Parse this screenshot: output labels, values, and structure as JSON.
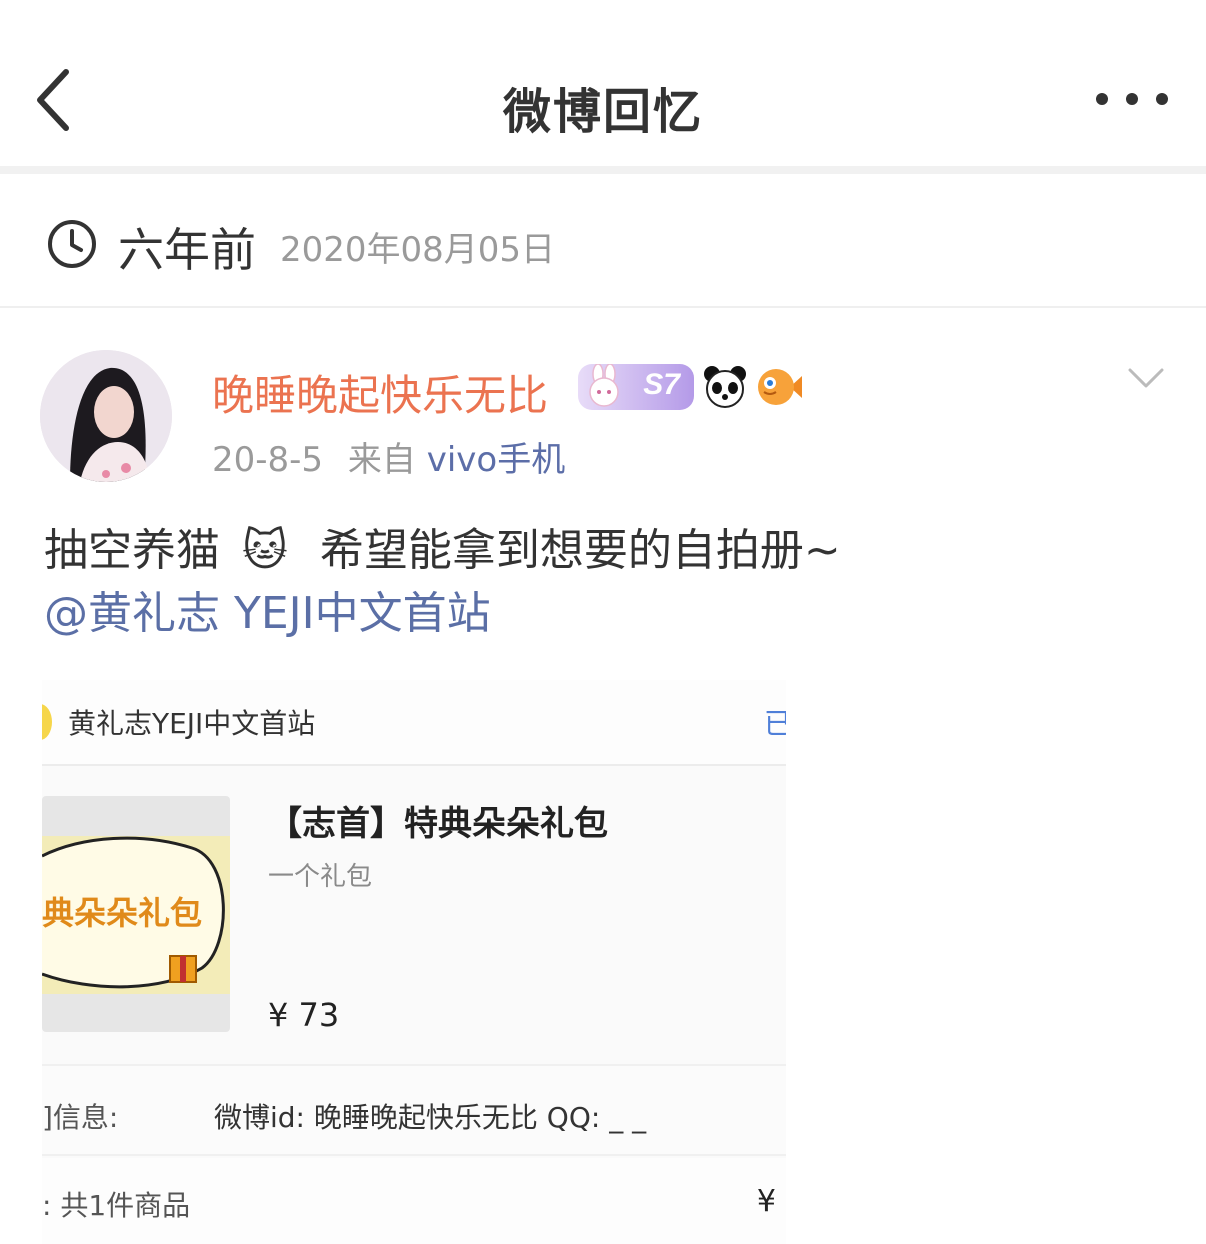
{
  "header": {
    "title": "微博回忆",
    "back_icon": "chevron-left-icon",
    "more_icon": "more-dots-icon"
  },
  "memory": {
    "time_ago": "六年前",
    "date": "2020年08月05日",
    "clock_icon": "clock-icon"
  },
  "post": {
    "username": "晚睡晚起快乐无比",
    "vip_level": "S7",
    "badges": [
      "vip-badge",
      "panda-icon",
      "fish-icon"
    ],
    "time": "20-8-5",
    "source_prefix": "来自",
    "source": "vivo手机",
    "text_before": "抽空养猫",
    "cat_emoji": "🐱",
    "text_after": "希望能拿到想要的自拍册~",
    "mention": "@黄礼志 YEJI中文首站"
  },
  "embedded_image": {
    "shop_name": "黄礼志YEJI中文首站",
    "follow_text": "已",
    "thumb_text": "典朵朵礼包",
    "product_title": "【志首】特典朵朵礼包",
    "product_sub": "一个礼包",
    "price": "¥ 73",
    "info_label": "]信息:",
    "info_value": "微博id: 晚睡晚起快乐无比 QQ: _ _",
    "count_label": ": 共1件商品",
    "count_yen": "¥"
  },
  "colors": {
    "username": "#eb7350",
    "link": "#5b6fa6",
    "muted": "#9a9a9a"
  }
}
